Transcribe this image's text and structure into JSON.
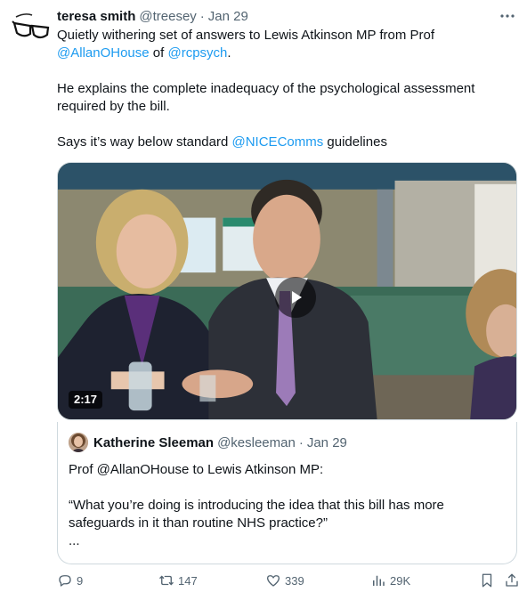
{
  "tweet": {
    "author_name": "teresa smith",
    "author_handle": "@treesey",
    "separator": "·",
    "date": "Jan 29",
    "body": {
      "line1_text": "Quietly withering set of answers to Lewis Atkinson MP from Prof",
      "mention1": "@AllanOHouse",
      "of_text": " of ",
      "mention2": "@rcpsych",
      "period": ".",
      "paragraph2": "He explains the complete inadequacy of the psychological assessment required by the bill.",
      "p3_text": "Says it’s way below standard ",
      "mention3": "@NICEComms",
      "p3_end": " guidelines"
    },
    "icons": {
      "more": "more-dots-icon",
      "avatar": "glasses-icon",
      "play": "play-icon"
    }
  },
  "media": {
    "duration": "2:17"
  },
  "quoted_tweet": {
    "author_name": "Katherine Sleeman",
    "author_handle": "@kesleeman",
    "separator": "·",
    "date": "Jan 29",
    "line1": "Prof @AllanOHouse to Lewis Atkinson MP:",
    "line2": "“What you’re doing is introducing the idea that this bill has more safeguards in it than routine NHS practice?”",
    "line3": "..."
  },
  "actions": {
    "replies": "9",
    "retweets": "147",
    "likes": "339",
    "views": "29K",
    "icons": [
      "reply-icon",
      "retweet-icon",
      "like-icon",
      "views-icon",
      "bookmark-icon",
      "share-icon"
    ]
  },
  "colors": {
    "text": "#0f1419",
    "secondary": "#536471",
    "link": "#1d9bf0",
    "border": "#cfd9de"
  }
}
